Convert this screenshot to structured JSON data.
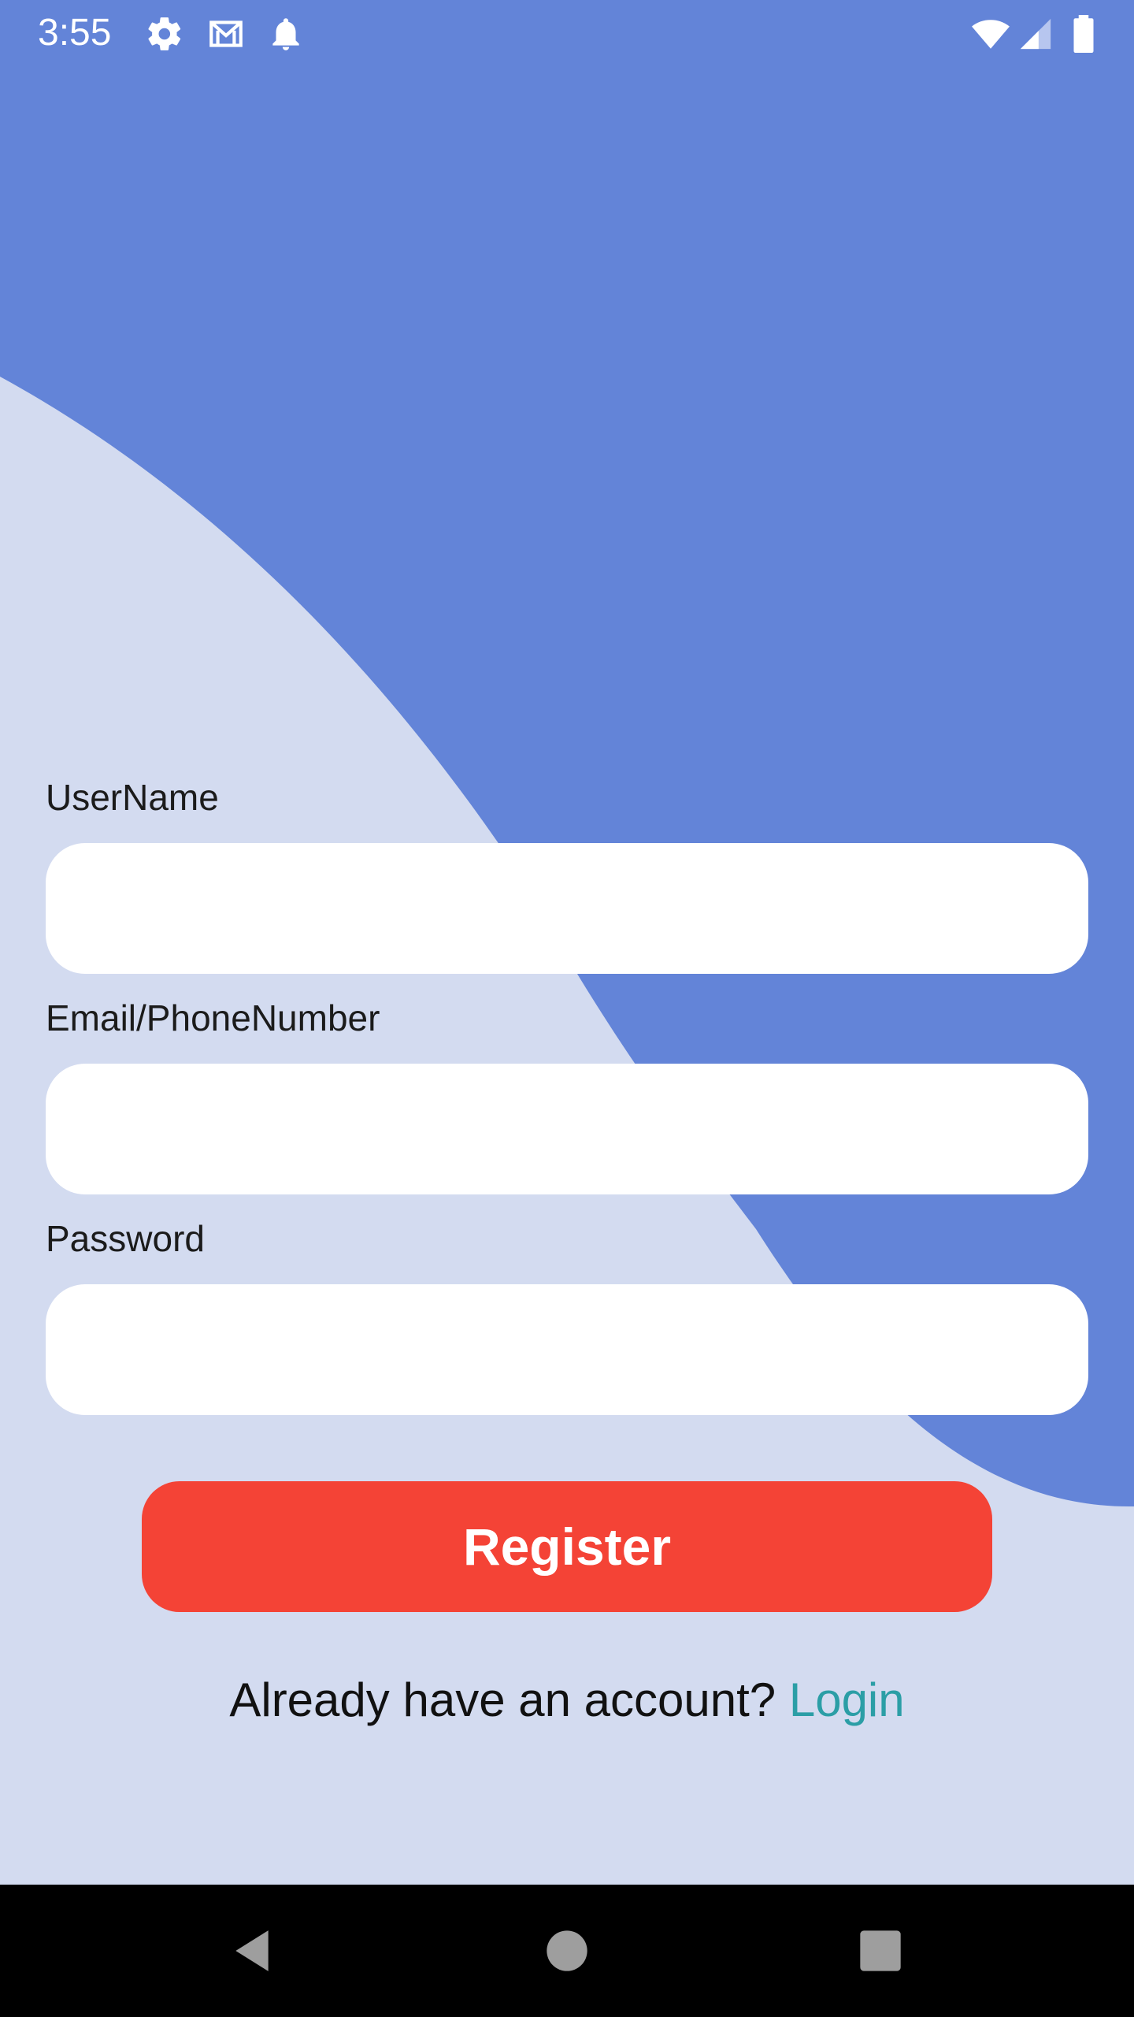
{
  "status_bar": {
    "time": "3:55",
    "left_icons": [
      "settings-icon",
      "gmail-icon",
      "notification-bell-icon"
    ],
    "right_icons": [
      "wifi-icon",
      "cell-signal-icon",
      "battery-icon"
    ]
  },
  "colors": {
    "background_light": "#d3dbf0",
    "background_blue": "#6384d8",
    "register_button": "#f44336",
    "login_link": "#2b9ea6",
    "nav_bar": "#000000"
  },
  "form": {
    "username_label": "UserName",
    "username_value": "",
    "email_label": "Email/PhoneNumber",
    "email_value": "",
    "password_label": "Password",
    "password_value": "",
    "register_label": "Register"
  },
  "footer": {
    "prompt": "Already have an account? ",
    "login_label": "Login"
  },
  "nav_bar": {
    "icons": [
      "back-icon",
      "home-icon",
      "recents-icon"
    ]
  }
}
